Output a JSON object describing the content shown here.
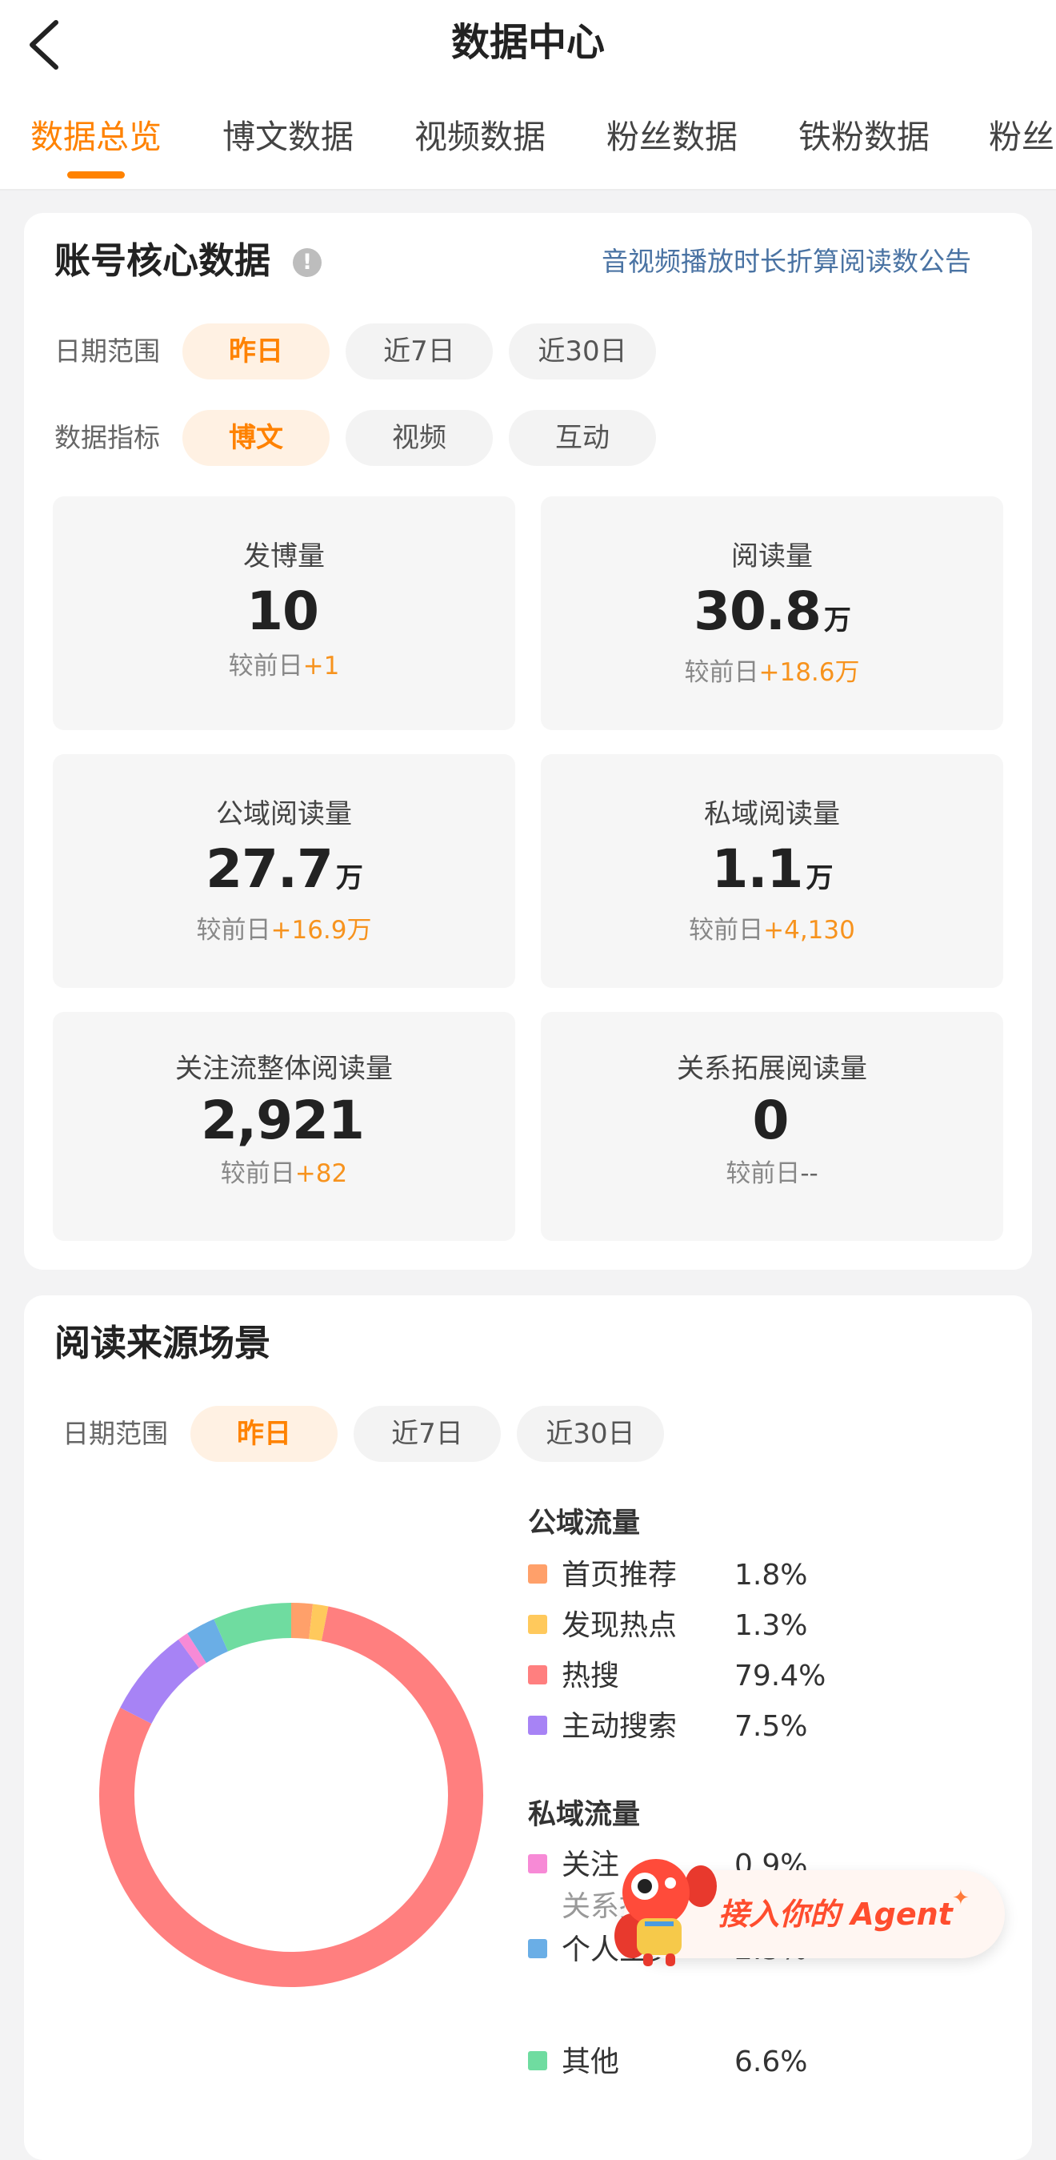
{
  "header": {
    "title": "数据中心"
  },
  "tabs": [
    {
      "label": "数据总览"
    },
    {
      "label": "博文数据"
    },
    {
      "label": "视频数据"
    },
    {
      "label": "粉丝数据"
    },
    {
      "label": "铁粉数据"
    },
    {
      "label": "粉丝"
    }
  ],
  "core": {
    "title": "账号核心数据",
    "info_icon": "!",
    "notice_link": "音视频播放时长折算阅读数公告",
    "date_range_label": "日期范围",
    "date_options": [
      "昨日",
      "近7日",
      "近30日"
    ],
    "metric_label": "数据指标",
    "metric_options": [
      "博文",
      "视频",
      "互动"
    ],
    "compare_prefix": "较前日",
    "stats": [
      {
        "label": "发博量",
        "value": "10",
        "unit": "",
        "delta": "+1"
      },
      {
        "label": "阅读量",
        "value": "30.8",
        "unit": "万",
        "delta": "+18.6万"
      },
      {
        "label": "公域阅读量",
        "value": "27.7",
        "unit": "万",
        "delta": "+16.9万"
      },
      {
        "label": "私域阅读量",
        "value": "1.1",
        "unit": "万",
        "delta": "+4,130"
      },
      {
        "label": "关注流整体阅读量",
        "value": "2,921",
        "unit": "",
        "delta": "+82"
      },
      {
        "label": "关系拓展阅读量",
        "value": "0",
        "unit": "",
        "delta": "--"
      }
    ]
  },
  "sources": {
    "title": "阅读来源场景",
    "date_range_label": "日期范围",
    "date_options": [
      "昨日",
      "近7日",
      "近30日"
    ],
    "public_title": "公域流量",
    "private_title": "私域流量",
    "public_items": [
      {
        "name": "首页推荐",
        "pct": "1.8%",
        "color": "#ffa06a"
      },
      {
        "name": "发现热点",
        "pct": "1.3%",
        "color": "#ffc95c"
      },
      {
        "name": "热搜",
        "pct": "79.4%",
        "color": "#ff7f7f"
      },
      {
        "name": "主动搜索",
        "pct": "7.5%",
        "color": "#a783f5"
      }
    ],
    "private_items": [
      {
        "name": "关注",
        "pct": "0.9%",
        "color": "#f78ad6"
      },
      {
        "name": "关系拓",
        "pct": "",
        "color": "#ffffff"
      },
      {
        "name": "个人主页",
        "pct": "2.5%",
        "color": "#6aaee6"
      },
      {
        "name": "其他",
        "pct": "6.6%",
        "color": "#6fdca0"
      }
    ]
  },
  "chart_data": {
    "type": "pie",
    "variant": "donut",
    "categories": [
      "首页推荐",
      "发现热点",
      "热搜",
      "主动搜索",
      "关注",
      "个人主页",
      "其他"
    ],
    "values": [
      1.8,
      1.3,
      79.4,
      7.5,
      0.9,
      2.5,
      6.6
    ],
    "colors": [
      "#ffa06a",
      "#ffc95c",
      "#ff7f7f",
      "#a783f5",
      "#f78ad6",
      "#6aaee6",
      "#6fdca0"
    ]
  },
  "agent_banner": {
    "text": "接入你的 Agent",
    "spark": "✦"
  },
  "colors": {
    "accent": "#ff8200",
    "link": "#4a73a3",
    "delta": "#f7931e"
  }
}
